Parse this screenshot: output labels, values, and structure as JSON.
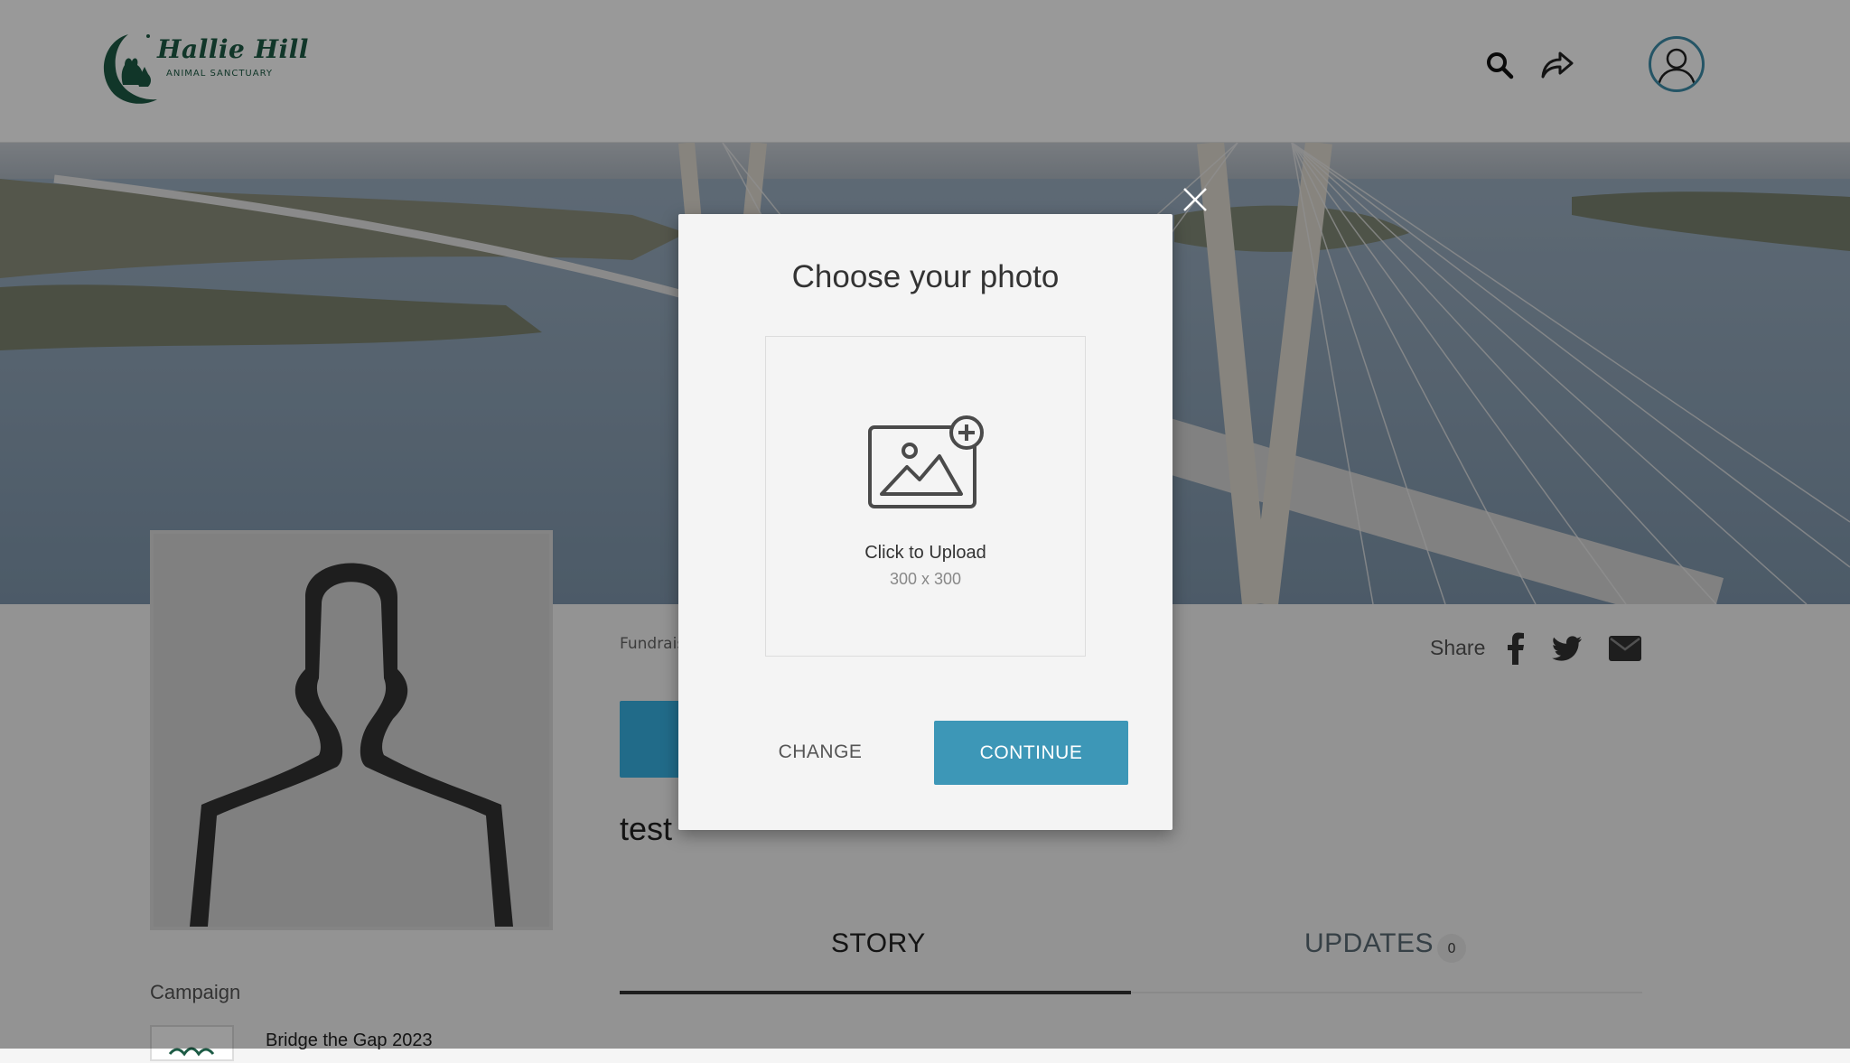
{
  "header": {
    "logo": {
      "name": "Hallie Hill",
      "subtitle": "ANIMAL SANCTUARY"
    },
    "icons": [
      "search-icon",
      "share-icon",
      "user-icon"
    ]
  },
  "colors": {
    "brand_green": "#1d5b45",
    "accent_blue": "#3d97b7",
    "donate_blue": "#37b3e5"
  },
  "profile": {
    "breadcrumb": "Fundrais",
    "title": "test",
    "share_label": "Share",
    "share_icons": [
      "facebook-icon",
      "twitter-icon",
      "email-icon"
    ]
  },
  "tabs": [
    {
      "label": "STORY",
      "active": true
    },
    {
      "label": "UPDATES",
      "badge": "0",
      "active": false
    }
  ],
  "campaign": {
    "label": "Campaign",
    "name": "Bridge the Gap 2023"
  },
  "modal": {
    "title": "Choose your photo",
    "upload_label": "Click to Upload",
    "upload_dimensions": "300 x 300",
    "change_label": "CHANGE",
    "continue_label": "CONTINUE"
  }
}
